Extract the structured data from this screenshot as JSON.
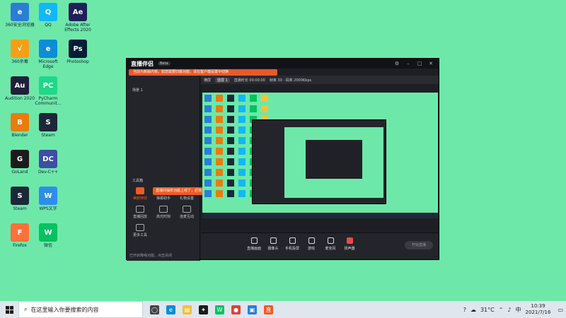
{
  "desktop": {
    "icons": [
      {
        "label": "360安全浏览器",
        "color": "#2a7fd4",
        "glyph": "e"
      },
      {
        "label": "360杀毒",
        "color": "#f3a018",
        "glyph": "√"
      },
      {
        "label": "Audition 2020",
        "color": "#1f1f3a",
        "glyph": "Au"
      },
      {
        "label": "Blender",
        "color": "#e87d0d",
        "glyph": "B"
      },
      {
        "label": "GoLand",
        "color": "#1b1b1b",
        "glyph": "G"
      },
      {
        "label": "Steam",
        "color": "#1b2838",
        "glyph": "S"
      },
      {
        "label": "Firefox",
        "color": "#ff7139",
        "glyph": "F"
      },
      {
        "label": "QQ",
        "color": "#12b7f5",
        "glyph": "Q"
      },
      {
        "label": "Microsoft Edge",
        "color": "#0c8dd6",
        "glyph": "e"
      },
      {
        "label": "PyCharm Communit...",
        "color": "#21d789",
        "glyph": "PC"
      },
      {
        "label": "Steam",
        "color": "#1b2838",
        "glyph": "S"
      },
      {
        "label": "Dev-C++",
        "color": "#3c4ea5",
        "glyph": "DC"
      },
      {
        "label": "WPS文字",
        "color": "#2f8dea",
        "glyph": "W"
      },
      {
        "label": "微信",
        "color": "#07c160",
        "glyph": "W"
      },
      {
        "label": "Adobe After Effects 2020",
        "color": "#1f1f5a",
        "glyph": "Ae"
      },
      {
        "label": "Photoshop",
        "color": "#001e36",
        "glyph": "Ps"
      }
    ]
  },
  "app": {
    "name": "直播伴侣",
    "version": "Beta",
    "notice": "当前为新版内核，如您需要旧版功能，请在客户端设置中切换",
    "scene_label": "场景 1",
    "tools_title": "工具箱",
    "tip": "直播间抽奖功能上线了，赶快试试吧~",
    "footnote": "已开启降噪功能，点击关闭",
    "topbar": {
      "tab": "横屏",
      "chip": "竖屏 1",
      "status": "直播时长 00:00:00",
      "extra": "帧率 30 · 码率 2000Kbps"
    },
    "tools": [
      {
        "label": "美颜特效",
        "active": true
      },
      {
        "label": "弹幕助手",
        "active": false
      },
      {
        "label": "礼物设置",
        "active": false
      },
      {
        "label": "直播回放",
        "active": false
      },
      {
        "label": "高光时刻",
        "active": false
      },
      {
        "label": "连麦互动",
        "active": false
      },
      {
        "label": "更多工具",
        "active": false
      }
    ],
    "controls": [
      {
        "label": "直播画面",
        "red": false
      },
      {
        "label": "摄像头",
        "red": false
      },
      {
        "label": "手机投屏",
        "red": false
      },
      {
        "label": "游戏",
        "red": false
      },
      {
        "label": "麦克风",
        "red": false
      },
      {
        "label": "扬声器",
        "red": true
      }
    ],
    "start_label": "开始直播",
    "window_buttons": [
      "设置",
      "_",
      "□",
      "✕"
    ]
  },
  "taskbar": {
    "search_placeholder": "在这里输入你要搜索的内容",
    "apps": [
      {
        "name": "task-view",
        "color": "#444",
        "glyph": "◯"
      },
      {
        "name": "edge",
        "color": "#0c8dd6",
        "glyph": "e"
      },
      {
        "name": "explorer",
        "color": "#f3c13a",
        "glyph": "▤"
      },
      {
        "name": "store",
        "color": "#1b1b1b",
        "glyph": "✦"
      },
      {
        "name": "wechat",
        "color": "#07c160",
        "glyph": "W"
      },
      {
        "name": "chrome",
        "color": "#db4437",
        "glyph": "●"
      },
      {
        "name": "app",
        "color": "#2a7fd4",
        "glyph": "▣"
      },
      {
        "name": "streamer",
        "color": "#f05a24",
        "glyph": "直"
      }
    ],
    "temperature": "31°C",
    "lang": "中",
    "time": "10:39",
    "date": "2021/7/16"
  }
}
